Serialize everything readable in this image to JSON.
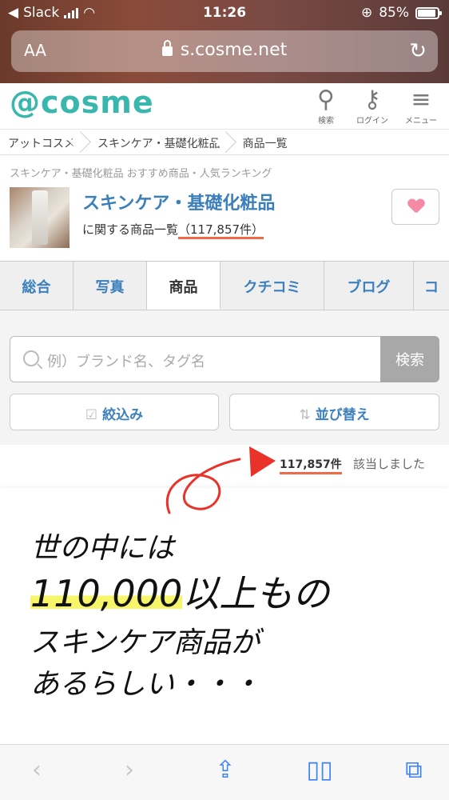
{
  "status": {
    "carrier": "Slack",
    "time": "11:26",
    "battery": "85%"
  },
  "browser": {
    "text_size_label": "AA",
    "url": "s.cosme.net"
  },
  "header": {
    "logo": "@cosme",
    "search_label": "検索",
    "login_label": "ログイン",
    "menu_label": "メニュー"
  },
  "breadcrumb": [
    "アットコスメ",
    "スキンケア・基礎化粧品",
    "商品一覧"
  ],
  "category": {
    "subtitle": "スキンケア・基礎化粧品 おすすめ商品・人気ランキング",
    "title": "スキンケア・基礎化粧品",
    "count_prefix": "に関する商品一覧",
    "count": "（117,857件）"
  },
  "tabs": [
    "総合",
    "写真",
    "商品",
    "クチコミ",
    "ブログ",
    "コ"
  ],
  "active_tab": 2,
  "search": {
    "placeholder": "例）ブランド名、タグ名",
    "button": "検索",
    "filter_label": "絞込み",
    "sort_label": "並び替え"
  },
  "results": {
    "count": "117,857件",
    "suffix": "該当しました"
  },
  "note": {
    "line1": "世の中には",
    "line2_highlight": "110,000",
    "line2_rest": "以上もの",
    "line3": "スキンケア商品が",
    "line4": "あるらしい・・・"
  },
  "colors": {
    "brand": "#3ab7ad",
    "link": "#3b7fbb",
    "annotation": "#e8322a",
    "highlight": "#f7f56a"
  }
}
